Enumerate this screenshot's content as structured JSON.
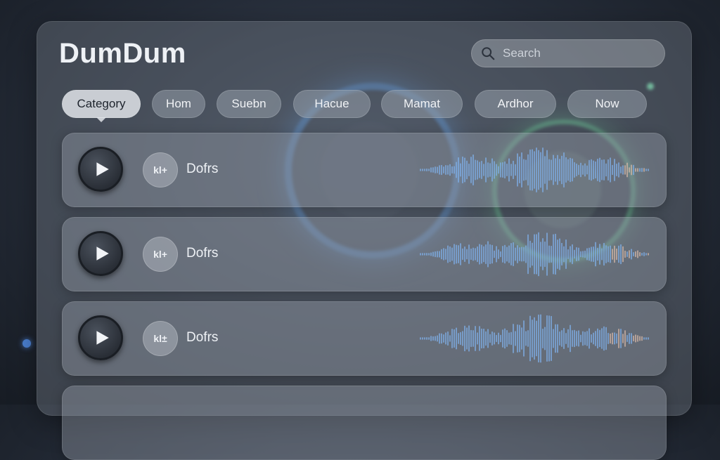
{
  "app": {
    "title": "DumDum"
  },
  "search": {
    "placeholder": "Search"
  },
  "categories": [
    {
      "label": "Category",
      "active": true
    },
    {
      "label": "Hom",
      "active": false
    },
    {
      "label": "Suebn",
      "active": false
    },
    {
      "label": "Hacue",
      "active": false
    },
    {
      "label": "Mamat",
      "active": false
    },
    {
      "label": "Ardhor",
      "active": false
    },
    {
      "label": "Now",
      "active": false
    }
  ],
  "tracks": [
    {
      "badge": "kl+",
      "name": "Dofrs",
      "play_icon": "play-icon"
    },
    {
      "badge": "kl+",
      "name": "Dofrs",
      "play_icon": "play-icon"
    },
    {
      "badge": "kl±",
      "name": "Dofrs",
      "play_icon": "play-icon"
    }
  ],
  "colors": {
    "accent_blue": "#7fb0ea",
    "accent_green": "#6fd8a6",
    "waveform_warm": "#d6b8a8"
  }
}
